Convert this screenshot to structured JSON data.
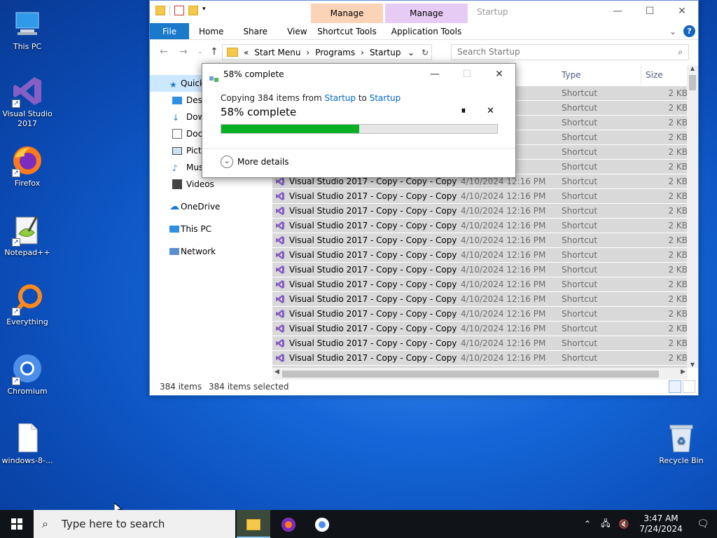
{
  "desktop": {
    "icons": [
      {
        "label": "This PC"
      },
      {
        "label": "Visual Studio 2017"
      },
      {
        "label": "Firefox"
      },
      {
        "label": "Notepad++"
      },
      {
        "label": "Everything"
      },
      {
        "label": "Chromium"
      },
      {
        "label": "windows-8-..."
      },
      {
        "label": "Recycle Bin"
      }
    ]
  },
  "explorer": {
    "title": "Startup",
    "manage_tabs": [
      {
        "label": "Manage",
        "sub": "Shortcut Tools",
        "color": "#fbd3b7"
      },
      {
        "label": "Manage",
        "sub": "Application Tools",
        "color": "#e6ccf5"
      }
    ],
    "ribbon": {
      "file": "File",
      "tabs": [
        "Home",
        "Share",
        "View"
      ]
    },
    "address": {
      "prefix": "«",
      "crumbs": [
        "Start Menu",
        "Programs",
        "Startup"
      ]
    },
    "search_placeholder": "Search Startup",
    "nav": {
      "quick": "Quick access",
      "items": [
        "Desktop",
        "Downloads",
        "Documents",
        "Pictures",
        "Music",
        "Videos"
      ],
      "onedrive": "OneDrive",
      "thispc": "This PC",
      "network": "Network"
    },
    "columns": {
      "type": "Type",
      "size": "Size"
    },
    "rows": [
      {
        "name": "",
        "date": "PM",
        "type": "Shortcut",
        "size": "2 KB"
      },
      {
        "name": "",
        "date": "PM",
        "type": "Shortcut",
        "size": "2 KB"
      },
      {
        "name": "",
        "date": "PM",
        "type": "Shortcut",
        "size": "2 KB"
      },
      {
        "name": "",
        "date": "PM",
        "type": "Shortcut",
        "size": "2 KB"
      },
      {
        "name": "",
        "date": "PM",
        "type": "Shortcut",
        "size": "2 KB"
      },
      {
        "name": "",
        "date": "PM",
        "type": "Shortcut",
        "size": "2 KB"
      },
      {
        "name": "Visual Studio 2017 - Copy - Copy - Copy ...",
        "date": "4/10/2024 12:16 PM",
        "type": "Shortcut",
        "size": "2 KB"
      },
      {
        "name": "Visual Studio 2017 - Copy - Copy - Copy ...",
        "date": "4/10/2024 12:16 PM",
        "type": "Shortcut",
        "size": "2 KB"
      },
      {
        "name": "Visual Studio 2017 - Copy - Copy - Copy ...",
        "date": "4/10/2024 12:16 PM",
        "type": "Shortcut",
        "size": "2 KB"
      },
      {
        "name": "Visual Studio 2017 - Copy - Copy - Copy ...",
        "date": "4/10/2024 12:16 PM",
        "type": "Shortcut",
        "size": "2 KB"
      },
      {
        "name": "Visual Studio 2017 - Copy - Copy - Copy ...",
        "date": "4/10/2024 12:16 PM",
        "type": "Shortcut",
        "size": "2 KB"
      },
      {
        "name": "Visual Studio 2017 - Copy - Copy - Copy ...",
        "date": "4/10/2024 12:16 PM",
        "type": "Shortcut",
        "size": "2 KB"
      },
      {
        "name": "Visual Studio 2017 - Copy - Copy - Copy ...",
        "date": "4/10/2024 12:16 PM",
        "type": "Shortcut",
        "size": "2 KB"
      },
      {
        "name": "Visual Studio 2017 - Copy - Copy - Copy ...",
        "date": "4/10/2024 12:16 PM",
        "type": "Shortcut",
        "size": "2 KB"
      },
      {
        "name": "Visual Studio 2017 - Copy - Copy - Copy ...",
        "date": "4/10/2024 12:16 PM",
        "type": "Shortcut",
        "size": "2 KB"
      },
      {
        "name": "Visual Studio 2017 - Copy - Copy - Copy ...",
        "date": "4/10/2024 12:16 PM",
        "type": "Shortcut",
        "size": "2 KB"
      },
      {
        "name": "Visual Studio 2017 - Copy - Copy - Copy ...",
        "date": "4/10/2024 12:16 PM",
        "type": "Shortcut",
        "size": "2 KB"
      },
      {
        "name": "Visual Studio 2017 - Copy - Copy - Copy ...",
        "date": "4/10/2024 12:16 PM",
        "type": "Shortcut",
        "size": "2 KB"
      },
      {
        "name": "Visual Studio 2017 - Copy - Copy - Copy ...",
        "date": "4/10/2024 12:16 PM",
        "type": "Shortcut",
        "size": "2 KB"
      },
      {
        "name": "Visual Studio 2017 - Copy - Copy - Copy ...",
        "date": "4/10/2024 12:16 PM",
        "type": "Shortcut",
        "size": "2 KB"
      }
    ],
    "status": {
      "count": "384 items",
      "selected": "384 items selected"
    }
  },
  "dialog": {
    "title": "58% complete",
    "copy_prefix": "Copying 384 items from",
    "from": "Startup",
    "to_word": "to",
    "to": "Startup",
    "percent_label": "58% complete",
    "progress": 0.5,
    "more_details": "More details"
  },
  "taskbar": {
    "search_placeholder": "Type here to search",
    "time": "3:47 AM",
    "date": "7/24/2024"
  },
  "colors": {
    "accent": "#1979ca",
    "progress": "#06b025",
    "selection": "#d9d9d9"
  }
}
